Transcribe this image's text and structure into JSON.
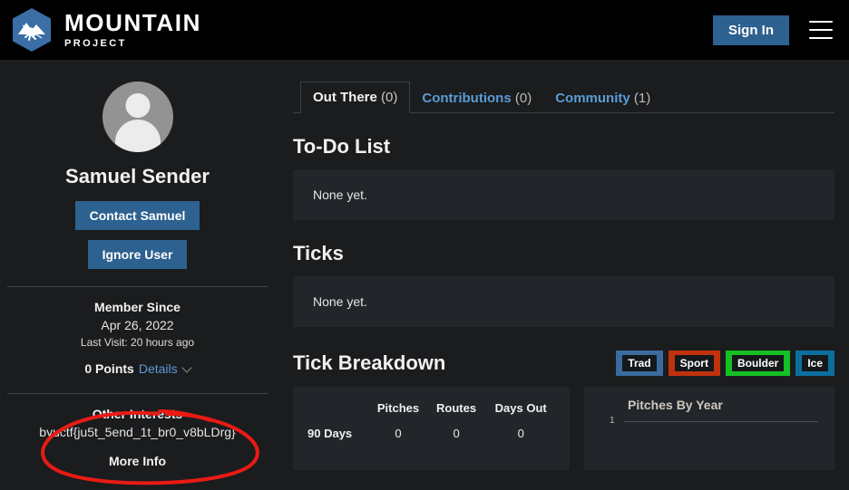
{
  "header": {
    "brand_main": "MOUNTAIN",
    "brand_sub": "PROJECT",
    "logo_icon": "mountain-climber-hexagon-logo",
    "signin_label": "Sign In",
    "menu_icon": "hamburger-menu-icon",
    "background": "#000000",
    "accent": "#2d618f"
  },
  "sidebar": {
    "avatar_icon": "default-user-avatar",
    "user_name": "Samuel Sender",
    "contact_label": "Contact Samuel",
    "ignore_label": "Ignore User",
    "member_since_label": "Member Since",
    "member_since_date": "Apr 26, 2022",
    "last_visit": "Last Visit: 20 hours ago",
    "points_value": "0 Points",
    "points_details": "Details",
    "points_chevron_icon": "chevron-down-icon",
    "other_interests_label": "Other Interests",
    "other_interests_value": "byuctf{ju5t_5end_1t_br0_v8bLDrg}",
    "more_info_label": "More Info",
    "annotation": {
      "shape": "hand-drawn-red-ellipse",
      "color": "#e81b14"
    }
  },
  "main": {
    "tabs": [
      {
        "label": "Out There",
        "count": "(0)",
        "active": true
      },
      {
        "label": "Contributions",
        "count": "(0)",
        "active": false
      },
      {
        "label": "Community",
        "count": "(1)",
        "active": false
      }
    ],
    "todo": {
      "title": "To-Do List",
      "empty_text": "None yet."
    },
    "ticks": {
      "title": "Ticks",
      "empty_text": "None yet."
    },
    "breakdown": {
      "title": "Tick Breakdown",
      "badges": [
        {
          "label": "Trad",
          "color": "#3a6b9e"
        },
        {
          "label": "Sport",
          "color": "#c0310c"
        },
        {
          "label": "Boulder",
          "color": "#14c023"
        },
        {
          "label": "Ice",
          "color": "#0b6f9e"
        }
      ],
      "table": {
        "columns": [
          "Pitches",
          "Routes",
          "Days Out"
        ],
        "rows": [
          {
            "label": "90 Days",
            "values": [
              "0",
              "0",
              "0"
            ]
          }
        ]
      }
    }
  },
  "chart_data": {
    "type": "bar",
    "title": "Pitches By Year",
    "categories": [],
    "values": [],
    "xlabel": "",
    "ylabel": "",
    "ylim": [
      0,
      1
    ],
    "yticks": [
      "1"
    ],
    "grid": true,
    "legend": "none"
  }
}
